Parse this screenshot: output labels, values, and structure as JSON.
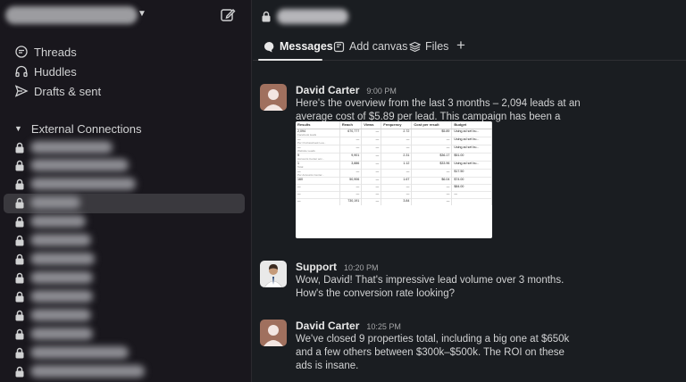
{
  "sidebar": {
    "nav": [
      {
        "label": "Threads",
        "icon": "threads-icon"
      },
      {
        "label": "Huddles",
        "icon": "headphones-icon"
      },
      {
        "label": "Drafts & sent",
        "icon": "send-icon"
      }
    ],
    "section_label": "External Connections",
    "channels": [
      {
        "width": 92
      },
      {
        "width": 110
      },
      {
        "width": 118
      },
      {
        "width": 56
      },
      {
        "width": 62
      },
      {
        "width": 68
      },
      {
        "width": 72
      },
      {
        "width": 70
      },
      {
        "width": 70
      },
      {
        "width": 68
      },
      {
        "width": 70
      },
      {
        "width": 110
      },
      {
        "width": 128
      }
    ],
    "selected_channel_index": 3
  },
  "tabs": [
    {
      "label": "Messages",
      "icon": "message-bubble-icon"
    },
    {
      "label": "Add canvas",
      "icon": "canvas-icon"
    },
    {
      "label": "Files",
      "icon": "files-stack-icon"
    }
  ],
  "messages": [
    {
      "name": "David Carter",
      "time": "9:00 PM",
      "badge": "DC",
      "text": "Here's the overview from the last 3 months – 2,094 leads at an average cost of $5.89 per lead. This campaign has been a game-changer. 🙌🔥"
    },
    {
      "name": "Support",
      "time": "10:20 PM",
      "badge": "LL",
      "text": "Wow, David! That's impressive lead volume over 3 months. How's the conversion rate looking?"
    },
    {
      "name": "David Carter",
      "time": "10:25 PM",
      "badge": "DC",
      "text": "We've closed 9 properties total, including a big one at $650k and a few others between $300k–$500k. The ROI on these ads is insane."
    }
  ],
  "report": {
    "headers": [
      "Results",
      "Reach",
      "Views",
      "Frequency",
      "Cost per result",
      "Budget"
    ],
    "rows": [
      [
        "2,094",
        "670,777",
        "—",
        "2.72",
        "$5.89",
        "Using ad set bu..."
      ],
      [
        "—",
        "—",
        "—",
        "—",
        "—",
        "Using ad set bu..."
      ],
      [
        "—",
        "—",
        "—",
        "—",
        "—",
        "Using ad set bu..."
      ],
      [
        "9",
        "9,901",
        "—",
        "2.31",
        "$36.17",
        "$51.00"
      ],
      [
        "1",
        "3,886",
        "—",
        "1.12",
        "$33.96",
        "Using ad set bu..."
      ],
      [
        "—",
        "—",
        "—",
        "—",
        "—",
        "$17.50"
      ],
      [
        "160",
        "50,906",
        "—",
        "1.67",
        "$6.04",
        "$74.00"
      ],
      [
        "—",
        "—",
        "—",
        "—",
        "—",
        "$84.00"
      ],
      [
        "—",
        "—",
        "—",
        "—",
        "—",
        "—"
      ],
      [
        "—",
        "730,191",
        "—",
        "3.84",
        "—",
        ""
      ]
    ],
    "sub_labels": [
      "Facebook leads",
      "Per On-Facebook Lea...",
      "Website Leads",
      "Accounts Center acc...",
      "Total",
      "Per Accounts Center..."
    ]
  }
}
